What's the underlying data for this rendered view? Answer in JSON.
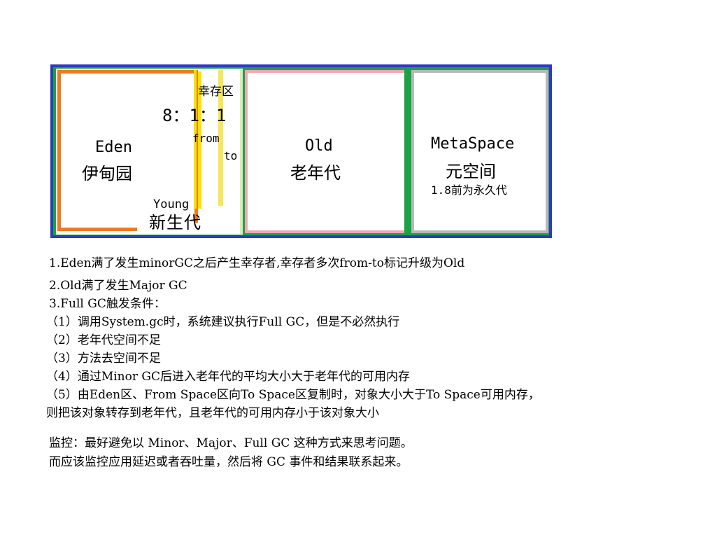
{
  "diagram": {
    "eden": {
      "en": "Eden",
      "cn": "伊甸园"
    },
    "ratio": "8：1：1",
    "survivor": {
      "cn": "幸存区",
      "from": "from",
      "to": "to"
    },
    "young": {
      "en": "Young",
      "cn": "新生代"
    },
    "old": {
      "en": "Old",
      "cn": "老年代"
    },
    "metaspace": {
      "en": "MetaSpace",
      "cn": "元空间",
      "note": "1.8前为永久代"
    },
    "colors": {
      "frame": "#2e3bbd",
      "green": "#1aa345",
      "eden": "#ee7a22",
      "survivor": "#f6e300",
      "old": "#f2a7b8",
      "metaspace": "#b9b9b9"
    }
  },
  "notes": {
    "line1": "1.Eden满了发生minorGC之后产生幸存者,幸存者多次from-to标记升级为Old",
    "line2": "2.Old满了发生Major GC",
    "line3": "3.Full GC触发条件：",
    "line4": "（1）调用System.gc时，系统建议执行Full GC，但是不必然执行",
    "line5": "（2）老年代空间不足",
    "line6": "（3）方法去空间不足",
    "line7": "（4）通过Minor GC后进入老年代的平均大小大于老年代的可用内存",
    "line8": "（5）由Eden区、From Space区向To Space区复制时，对象大小大于To Space可用内存，",
    "line9": "则把该对象转存到老年代，且老年代的可用内存小于该对象大小"
  },
  "monitoring": {
    "line1": "监控：最好避免以 Minor、Major、Full GC 这种方式来思考问题。",
    "line2": "而应该监控应用延迟或者吞吐量，然后将 GC 事件和结果联系起来。"
  }
}
